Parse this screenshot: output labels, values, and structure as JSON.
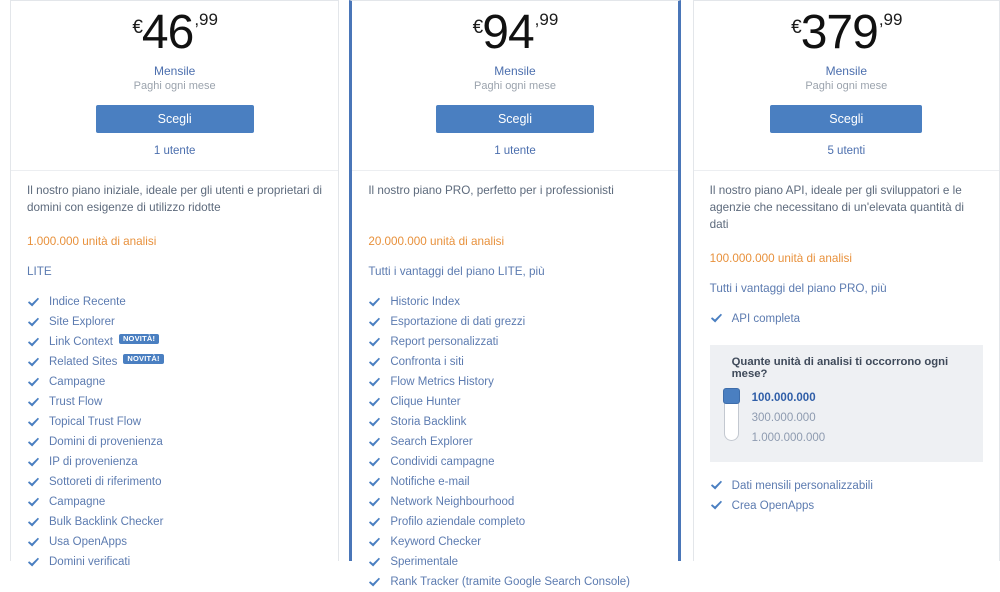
{
  "plans": [
    {
      "id": "lite",
      "currency": "€",
      "amount": "46",
      "cents": ",99",
      "period": "Mensile",
      "period_sub": "Paghi ogni mese",
      "choose_label": "Scegli",
      "users": "1 utente",
      "description": "Il nostro piano iniziale, ideale per gli utenti e proprietari di domini con esigenze di utilizzo ridotte",
      "units": "1.000.000 unità di analisi",
      "tier": "LITE",
      "features": [
        {
          "label": "Indice Recente"
        },
        {
          "label": "Site Explorer"
        },
        {
          "label": "Link Context",
          "badge": "NOVITÀ!"
        },
        {
          "label": "Related Sites",
          "badge": "NOVITÀ!"
        },
        {
          "label": "Campagne"
        },
        {
          "label": "Trust Flow"
        },
        {
          "label": "Topical Trust Flow"
        },
        {
          "label": "Domini di provenienza"
        },
        {
          "label": "IP di provenienza"
        },
        {
          "label": "Sottoreti di riferimento"
        },
        {
          "label": "Campagne"
        },
        {
          "label": "Bulk Backlink Checker"
        },
        {
          "label": "Usa OpenApps"
        },
        {
          "label": "Domini verificati"
        }
      ]
    },
    {
      "id": "pro",
      "currency": "€",
      "amount": "94",
      "cents": ",99",
      "period": "Mensile",
      "period_sub": "Paghi ogni mese",
      "choose_label": "Scegli",
      "users": "1 utente",
      "description": "Il nostro piano PRO, perfetto per i professionisti",
      "units": "20.000.000 unità di analisi",
      "tier": "Tutti i vantaggi del piano LITE, più",
      "features": [
        {
          "label": "Historic Index"
        },
        {
          "label": "Esportazione di dati grezzi"
        },
        {
          "label": "Report personalizzati"
        },
        {
          "label": "Confronta i siti"
        },
        {
          "label": "Flow Metrics History"
        },
        {
          "label": "Clique Hunter"
        },
        {
          "label": "Storia Backlink"
        },
        {
          "label": "Search Explorer"
        },
        {
          "label": "Condividi campagne"
        },
        {
          "label": "Notifiche e-mail"
        },
        {
          "label": "Network Neighbourhood"
        },
        {
          "label": "Profilo aziendale completo"
        },
        {
          "label": "Keyword Checker"
        },
        {
          "label": "Sperimentale"
        },
        {
          "label": "Rank Tracker (tramite Google Search Console)"
        }
      ]
    },
    {
      "id": "api",
      "currency": "€",
      "amount": "379",
      "cents": ",99",
      "period": "Mensile",
      "period_sub": "Paghi ogni mese",
      "choose_label": "Scegli",
      "users": "5 utenti",
      "description": "Il nostro piano API, ideale per gli sviluppatori e le agenzie che necessitano di un'elevata quantità di dati",
      "units": "100.000.000 unità di analisi",
      "tier": "Tutti i vantaggi del piano PRO, più",
      "features": [
        {
          "label": "API completa"
        }
      ],
      "slider": {
        "question": "Quante unità di analisi ti occorrono ogni mese?",
        "options": [
          "100.000.000",
          "300.000.000",
          "1.000.000.000"
        ],
        "selected_index": 0
      },
      "post_features": [
        {
          "label": "Dati mensili personalizzabili"
        },
        {
          "label": "Crea OpenApps"
        }
      ]
    }
  ],
  "colors": {
    "accent_blue": "#4a7fc1",
    "border_blue": "#4a76b8",
    "orange": "#e8913c",
    "feature_text": "#5c7bb0",
    "muted": "#9ba3ad"
  },
  "icons": {
    "check": "check-icon"
  }
}
